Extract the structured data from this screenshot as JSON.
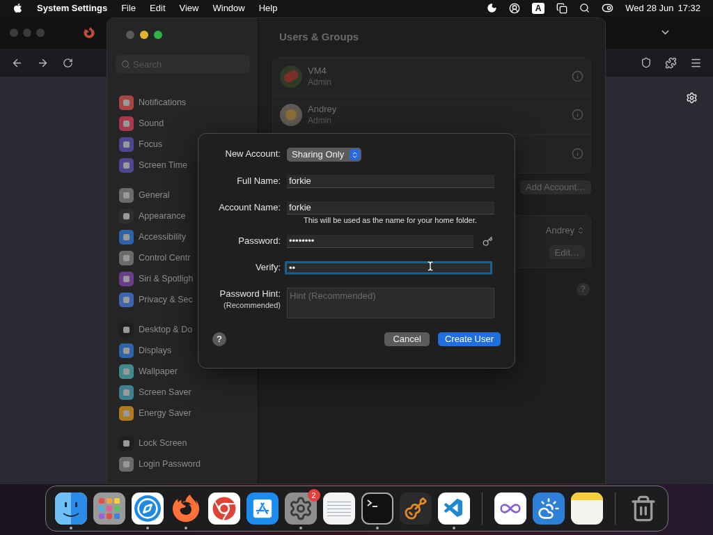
{
  "menu_bar": {
    "app_name": "System Settings",
    "menus": [
      "File",
      "Edit",
      "View",
      "Window",
      "Help"
    ],
    "input_source": "A",
    "date": "Wed 28 Jun",
    "time": "17:32"
  },
  "settings": {
    "search": {
      "placeholder": "Search"
    },
    "sidebar_groups": [
      [
        {
          "label": "Notifications",
          "color": "#a84646"
        },
        {
          "label": "Sound",
          "color": "#a8394a"
        },
        {
          "label": "Focus",
          "color": "#4f4691"
        },
        {
          "label": "Screen Time",
          "color": "#4f4691"
        }
      ],
      [
        {
          "label": "General",
          "color": "#6b6b6b"
        },
        {
          "label": "Appearance",
          "color": "#2e2e2e"
        },
        {
          "label": "Accessibility",
          "color": "#2f63a8"
        },
        {
          "label": "Control Centr",
          "color": "#6b6b6b"
        },
        {
          "label": "Siri & Spotligh",
          "color": "#6a3f8a"
        },
        {
          "label": "Privacy & Sec",
          "color": "#3a66b0"
        }
      ],
      [
        {
          "label": "Desktop & Do",
          "color": "#1f1f1f"
        },
        {
          "label": "Displays",
          "color": "#2f63a8"
        },
        {
          "label": "Wallpaper",
          "color": "#3f8a8a"
        },
        {
          "label": "Screen Saver",
          "color": "#3f7f8f"
        },
        {
          "label": "Energy Saver",
          "color": "#b07a1e"
        }
      ],
      [
        {
          "label": "Lock Screen",
          "color": "#1f1f1f"
        },
        {
          "label": "Login Password",
          "color": "#6b6b6b"
        }
      ]
    ],
    "page_title": "Users & Groups",
    "users": [
      {
        "name": "VM4",
        "role": "Admin"
      },
      {
        "name": "Andrey",
        "role": "Admin"
      }
    ],
    "add_account_button": "Add Account…",
    "auto_login_value": "Andrey",
    "edit_button": "Edit…",
    "help_label": "?"
  },
  "dialog": {
    "rows": [
      {
        "kind": "popup",
        "label": "New Account:",
        "value": "Sharing Only",
        "focused": false
      },
      {
        "kind": "text",
        "label": "Full Name:",
        "value": "forkie",
        "focused": false
      },
      {
        "kind": "text",
        "label": "Account Name:",
        "value": "forkie",
        "note": "This will be used as the name for your home folder.",
        "focused": false
      },
      {
        "kind": "password",
        "label": "Password:",
        "value": "••••••••",
        "focused": false
      },
      {
        "kind": "text",
        "label": "Verify:",
        "value": "••",
        "focused": true
      },
      {
        "kind": "textarea",
        "label": "Password Hint:",
        "sublabel": "(Recommended)",
        "placeholder": "Hint (Recommended)",
        "focused": false
      }
    ],
    "help_label": "?",
    "cancel_button": "Cancel",
    "confirm_button": "Create User"
  },
  "dock": [
    {
      "kind": "finder",
      "running": true
    },
    {
      "kind": "launchpad",
      "running": false
    },
    {
      "kind": "safari",
      "running": true
    },
    {
      "kind": "firefox",
      "running": true
    },
    {
      "kind": "chrome",
      "running": false
    },
    {
      "kind": "appstore",
      "running": false
    },
    {
      "kind": "settings",
      "running": true,
      "badge": "2"
    },
    {
      "kind": "textedit",
      "running": false
    },
    {
      "kind": "terminal",
      "running": true
    },
    {
      "kind": "garageband",
      "running": false
    },
    {
      "kind": "vscode",
      "running": true
    },
    {
      "kind": "separator"
    },
    {
      "kind": "visualstudio",
      "running": false
    },
    {
      "kind": "weather",
      "running": false
    },
    {
      "kind": "notes",
      "running": false
    },
    {
      "kind": "separator"
    },
    {
      "kind": "trash",
      "running": false
    }
  ]
}
